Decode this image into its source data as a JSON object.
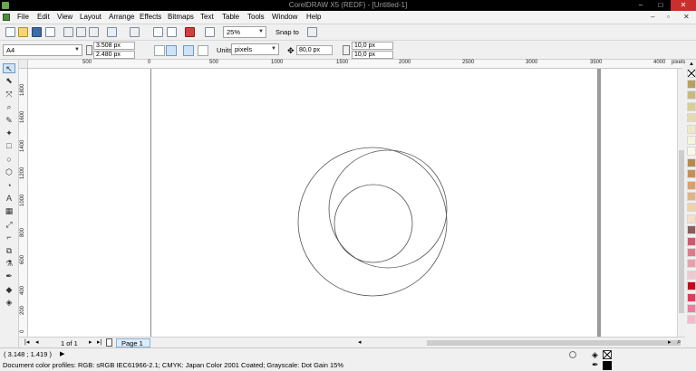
{
  "window": {
    "title": "CorelDRAW X5 (REDF) - [Untitled-1]",
    "minimize": "–",
    "restore": "□",
    "close": "✕"
  },
  "menu": [
    "File",
    "Edit",
    "View",
    "Layout",
    "Arrange",
    "Effects",
    "Bitmaps",
    "Text",
    "Table",
    "Tools",
    "Window",
    "Help"
  ],
  "doc_controls": {
    "minimize": "–",
    "restore": "▫",
    "close": "✕"
  },
  "standard_toolbar": {
    "zoom": "25%",
    "snap_to": "Snap to"
  },
  "property_bar": {
    "paper": "A4",
    "width": "3.508 px",
    "height": "2.480 px",
    "units_label": "Units:",
    "units": "pixels",
    "nudge": "80,0 px",
    "dup_x": "10,0 px",
    "dup_y": "10,0 px"
  },
  "ruler_top": {
    "labels": [
      "500",
      "0",
      "500",
      "1000",
      "1500",
      "2000",
      "2500",
      "3000",
      "3500",
      "4000",
      "pixels"
    ]
  },
  "ruler_left": {
    "labels": [
      "1800",
      "1600",
      "1400",
      "1200",
      "1000",
      "800",
      "600",
      "400",
      "200",
      "0"
    ]
  },
  "tools": [
    {
      "icon": "pick-tool-icon",
      "glyph": "↖"
    },
    {
      "icon": "shape-tool-icon",
      "glyph": "⬉"
    },
    {
      "icon": "crop-tool-icon",
      "glyph": "⤧"
    },
    {
      "icon": "zoom-tool-icon",
      "glyph": "⌕"
    },
    {
      "icon": "freehand-tool-icon",
      "glyph": "✎"
    },
    {
      "icon": "smart-fill-tool-icon",
      "glyph": "✦"
    },
    {
      "icon": "rectangle-tool-icon",
      "glyph": "□"
    },
    {
      "icon": "ellipse-tool-icon",
      "glyph": "○"
    },
    {
      "icon": "polygon-tool-icon",
      "glyph": "⬡"
    },
    {
      "icon": "basic-shapes-tool-icon",
      "glyph": "◔"
    },
    {
      "icon": "text-tool-icon",
      "glyph": "A"
    },
    {
      "icon": "table-tool-icon",
      "glyph": "▦"
    },
    {
      "icon": "parallel-dimension-tool-icon",
      "glyph": "⤢"
    },
    {
      "icon": "straight-connector-tool-icon",
      "glyph": "⌐"
    },
    {
      "icon": "blend-tool-icon",
      "glyph": "⧉"
    },
    {
      "icon": "eyedropper-tool-icon",
      "glyph": "⚗"
    },
    {
      "icon": "outline-pen-tool-icon",
      "glyph": "✒"
    },
    {
      "icon": "fill-tool-icon",
      "glyph": "◆"
    },
    {
      "icon": "interactive-fill-tool-icon",
      "glyph": "◈"
    }
  ],
  "palette_colors": [
    "#b7a05c",
    "#c9ba7c",
    "#d8cf92",
    "#e5dcab",
    "#efe8c4",
    "#f7f3dc",
    "#fbf7e6",
    "#b58a4f",
    "#c78f56",
    "#d9a06a",
    "#e3b384",
    "#f0d2a5",
    "#f6dfc4",
    "#8a5c5c",
    "#c85c6c",
    "#e07a8a",
    "#e8a0ac",
    "#f0c8cf",
    "#d0021b",
    "#e23a5a",
    "#f07a9a",
    "#f8b8c8"
  ],
  "page_nav": {
    "counter": "1 of 1",
    "page_tab": "Page 1"
  },
  "status": {
    "cursor": "( 3.148 ; 1.419 )",
    "profiles": "Document color profiles: RGB: sRGB IEC61966-2.1; CMYK: Japan Color 2001 Coated; Grayscale: Dot Gain 15%"
  }
}
